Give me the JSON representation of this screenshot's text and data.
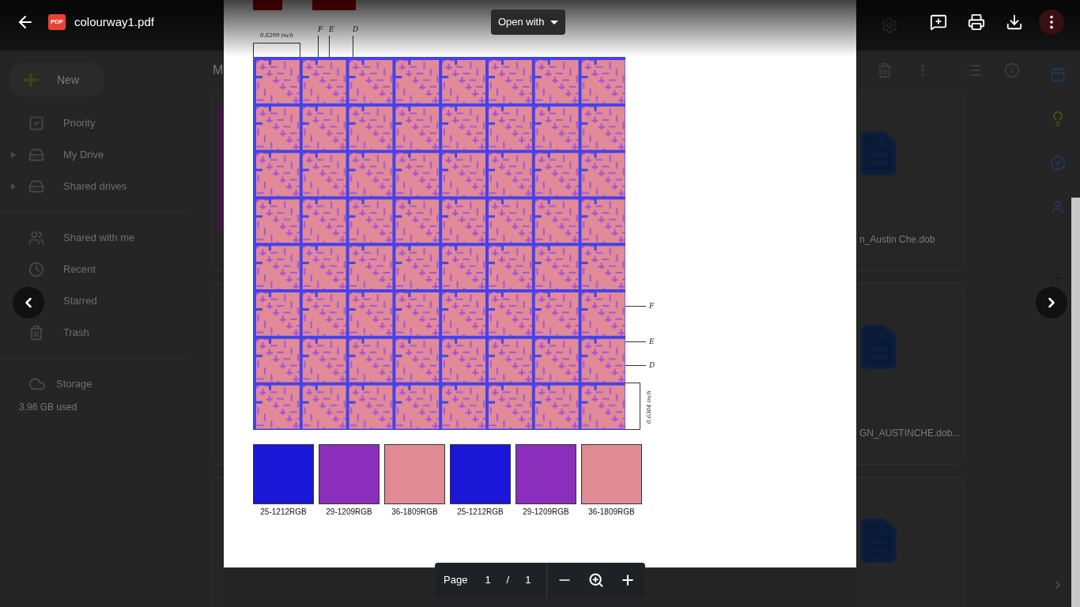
{
  "viewer": {
    "file_badge": "PDF",
    "file_name": "colourway1.pdf",
    "open_with": "Open with",
    "page_label": "Page",
    "page_current": "1",
    "page_separator": "/",
    "page_total": "1"
  },
  "drive": {
    "new_button": "New",
    "heading": "M",
    "nav": [
      {
        "label": "Priority",
        "kind": "priority",
        "expandable": false
      },
      {
        "label": "My Drive",
        "kind": "drive",
        "expandable": true
      },
      {
        "label": "Shared drives",
        "kind": "shared-drives",
        "expandable": true
      },
      {
        "label": "Shared with me",
        "kind": "shared",
        "expandable": false
      },
      {
        "label": "Recent",
        "kind": "recent",
        "expandable": false
      },
      {
        "label": "Starred",
        "kind": "starred",
        "expandable": false
      },
      {
        "label": "Trash",
        "kind": "trash",
        "expandable": false
      }
    ],
    "storage": {
      "label": "Storage",
      "usage": "3.96 GB used"
    },
    "files": [
      "n_Austin Che.dob",
      "GN_AUSTINCHE.dob..."
    ]
  },
  "document": {
    "top_dimension": "0.6299 inch",
    "top_marks": [
      "F",
      "E",
      "D"
    ],
    "side_marks": [
      "F",
      "E",
      "D"
    ],
    "side_dimension": "0.6304 inch",
    "swatches": [
      {
        "label": "25-1212RGB",
        "color": "#1a17d6"
      },
      {
        "label": "29-1209RGB",
        "color": "#8b2ebc"
      },
      {
        "label": "36-1809RGB",
        "color": "#e08a94"
      },
      {
        "label": "25-1212RGB",
        "color": "#1a17d6"
      },
      {
        "label": "29-1209RGB",
        "color": "#8b2ebc"
      },
      {
        "label": "36-1809RGB",
        "color": "#e08a94"
      }
    ]
  }
}
